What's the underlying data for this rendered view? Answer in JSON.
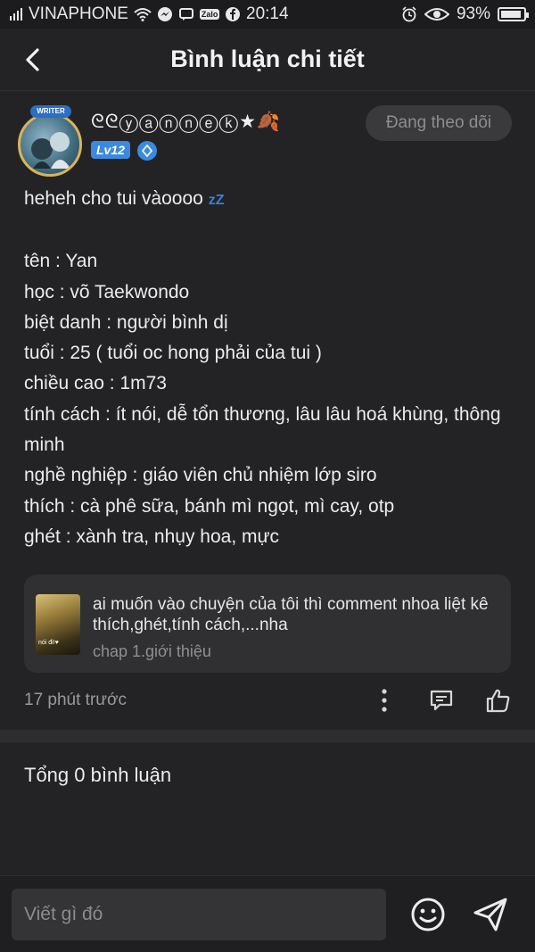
{
  "status_bar": {
    "carrier": "VINAPHONE",
    "time": "20:14",
    "battery": "93%",
    "battery_level": 0.93,
    "zalo_label": "Zalo"
  },
  "header": {
    "title": "Bình luận chi tiết"
  },
  "post": {
    "author_name": "ᘓᘓⓨⓐⓝⓝⓔⓚ★🍂",
    "level": "Lv12",
    "avatar_tag": "WRITER",
    "follow_label": "Đang theo dõi",
    "lines": [
      "heheh cho tui vàoooo",
      "",
      "tên : Yan",
      "học : võ Taekwondo",
      "biệt danh : người bình dị",
      "tuổi : 25 ( tuổi oc hong phải của tui )",
      "chiều cao : 1m73",
      "tính cách : ít nói, dễ tổn thương, lâu lâu hoá khùng, thông minh",
      "nghề nghiệp : giáo viên chủ nhiệm lớp siro",
      "thích : cà phê sữa, bánh mì ngọt, mì cay, otp",
      "ghét : xành tra, nhụy hoa, mực"
    ],
    "sleep_emoji": "zZ",
    "card": {
      "thumb_label": "nói đi!♥",
      "text": "ai muốn vào chuyện của tôi thì comment nhoa liệt kê thích,ghét,tính cách,...nha",
      "subtitle": "chap 1.giới thiệu"
    },
    "time_ago": "17 phút trước"
  },
  "comments": {
    "total_label": "Tổng 0 bình luận"
  },
  "composer": {
    "placeholder": "Viết gì đó"
  },
  "colors": {
    "background": "#232325",
    "accent_blue": "#3a8ae0"
  }
}
